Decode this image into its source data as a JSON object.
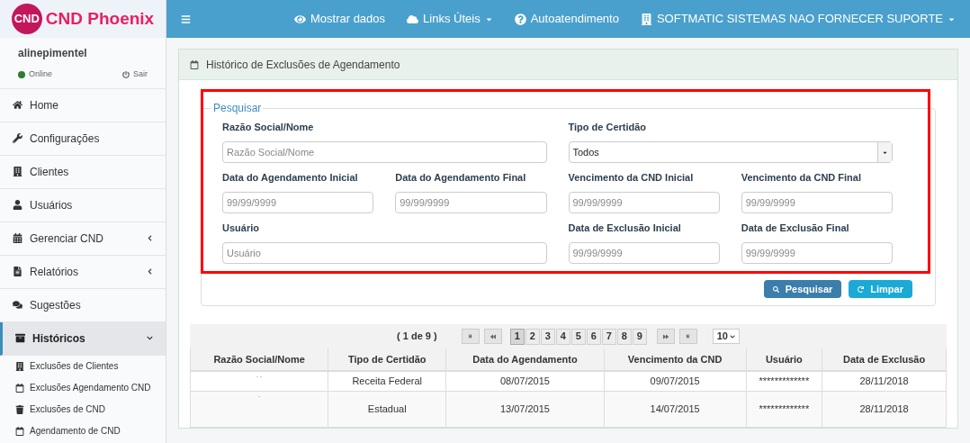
{
  "brand": {
    "badge": "CND",
    "name": "CND Phoenix"
  },
  "user": {
    "name": "alinepimentel",
    "status": "Online",
    "logout": "Sair"
  },
  "sidebar": {
    "items": [
      {
        "label": "Home",
        "has_submenu": false,
        "expanded": false,
        "selected": false
      },
      {
        "label": "Configurações",
        "has_submenu": false,
        "expanded": false,
        "selected": false
      },
      {
        "label": "Clientes",
        "has_submenu": false,
        "expanded": false,
        "selected": false
      },
      {
        "label": "Usuários",
        "has_submenu": false,
        "expanded": false,
        "selected": false
      },
      {
        "label": "Gerenciar CND",
        "has_submenu": true,
        "expanded": false,
        "selected": false
      },
      {
        "label": "Relatórios",
        "has_submenu": true,
        "expanded": false,
        "selected": false
      },
      {
        "label": "Sugestões",
        "has_submenu": false,
        "expanded": false,
        "selected": false
      },
      {
        "label": "Históricos",
        "has_submenu": true,
        "expanded": true,
        "selected": true,
        "children": [
          {
            "label": "Exclusões de Clientes"
          },
          {
            "label": "Exclusões Agendamento CND"
          },
          {
            "label": "Exclusões de CND"
          },
          {
            "label": "Agendamento de CND"
          }
        ]
      }
    ]
  },
  "topbar": {
    "items": [
      {
        "label": "Mostrar dados",
        "dropdown": false
      },
      {
        "label": "Links Úteis",
        "dropdown": true
      },
      {
        "label": "Autoatendimento",
        "dropdown": false
      },
      {
        "label": "SOFTMATIC SISTEMAS NAO FORNECER SUPORTE",
        "dropdown": true
      }
    ]
  },
  "panel": {
    "title": "Histórico de Exclusões de Agendamento",
    "search": {
      "legend": "Pesquisar",
      "fields": [
        {
          "kind": "wide",
          "label": "Razão Social/Nome",
          "placeholder": "Razão Social/Nome"
        },
        {
          "kind": "select",
          "label": "Tipo de Certidão",
          "value": "Todos"
        },
        {
          "kind": "narrow",
          "label": "Data do Agendamento Inicial",
          "placeholder": "99/99/9999"
        },
        {
          "kind": "narrow",
          "label": "Data do Agendamento Final",
          "placeholder": "99/99/9999"
        },
        {
          "kind": "narrow",
          "label": "Vencimento da CND Inicial",
          "placeholder": "99/99/9999"
        },
        {
          "kind": "narrow",
          "label": "Vencimento da CND Final",
          "placeholder": "99/99/9999"
        },
        {
          "kind": "wide",
          "label": "Usuário",
          "placeholder": "Usuário"
        },
        {
          "kind": "narrow",
          "label": "Data de Exclusão Inicial",
          "placeholder": "99/99/9999"
        },
        {
          "kind": "narrow",
          "label": "Data de Exclusão Final",
          "placeholder": "99/99/9999"
        }
      ],
      "buttons": [
        {
          "label": "Pesquisar",
          "kind": "primary"
        },
        {
          "label": "Limpar",
          "kind": "info"
        }
      ]
    },
    "pager": {
      "summary": "( 1 de 9 )",
      "pages": [
        {
          "label": "1",
          "selected": true
        },
        {
          "label": "2",
          "selected": false
        },
        {
          "label": "3",
          "selected": false
        },
        {
          "label": "4",
          "selected": false
        },
        {
          "label": "5",
          "selected": false
        },
        {
          "label": "6",
          "selected": false
        },
        {
          "label": "7",
          "selected": false
        },
        {
          "label": "8",
          "selected": false
        },
        {
          "label": "9",
          "selected": false
        }
      ],
      "page_size": "10"
    },
    "table": {
      "columns": [
        "Razão Social/Nome",
        "Tipo de Certidão",
        "Data do Agendamento",
        "Vencimento da CND",
        "Usuário",
        "Data de Exclusão"
      ],
      "rows": [
        [
          "- -",
          "Receita Federal",
          "08/07/2015",
          "09/07/2015",
          "*************",
          "28/11/2018"
        ],
        [
          "-",
          "Estadual",
          "13/07/2015",
          "14/07/2015",
          "*************",
          "28/11/2018"
        ]
      ]
    }
  }
}
